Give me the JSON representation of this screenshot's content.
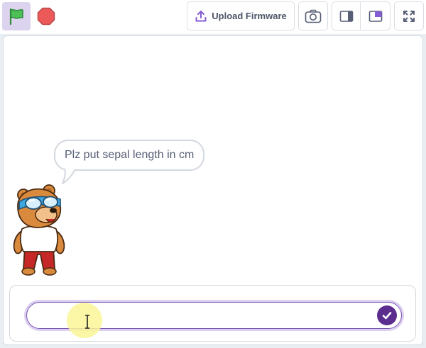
{
  "toolbar": {
    "upload_label": "Upload Firmware",
    "icons": {
      "green_flag": "green-flag-icon",
      "stop": "stop-icon",
      "upload": "upload-icon",
      "camera": "camera-icon",
      "small_stage": "small-stage-layout-icon",
      "large_stage": "large-stage-layout-icon",
      "fullscreen": "fullscreen-icon"
    }
  },
  "stage": {
    "speech_bubble": "Plz put sepal length in cm",
    "sprite": "bear-sprite"
  },
  "ask_prompt": {
    "value": "",
    "placeholder": ""
  },
  "colors": {
    "accent": "#855cd6",
    "submit": "#5b2d8e",
    "flag_active_bg": "#dcd3ee",
    "stop": "#ec5959",
    "flag": "#4cbf56"
  }
}
